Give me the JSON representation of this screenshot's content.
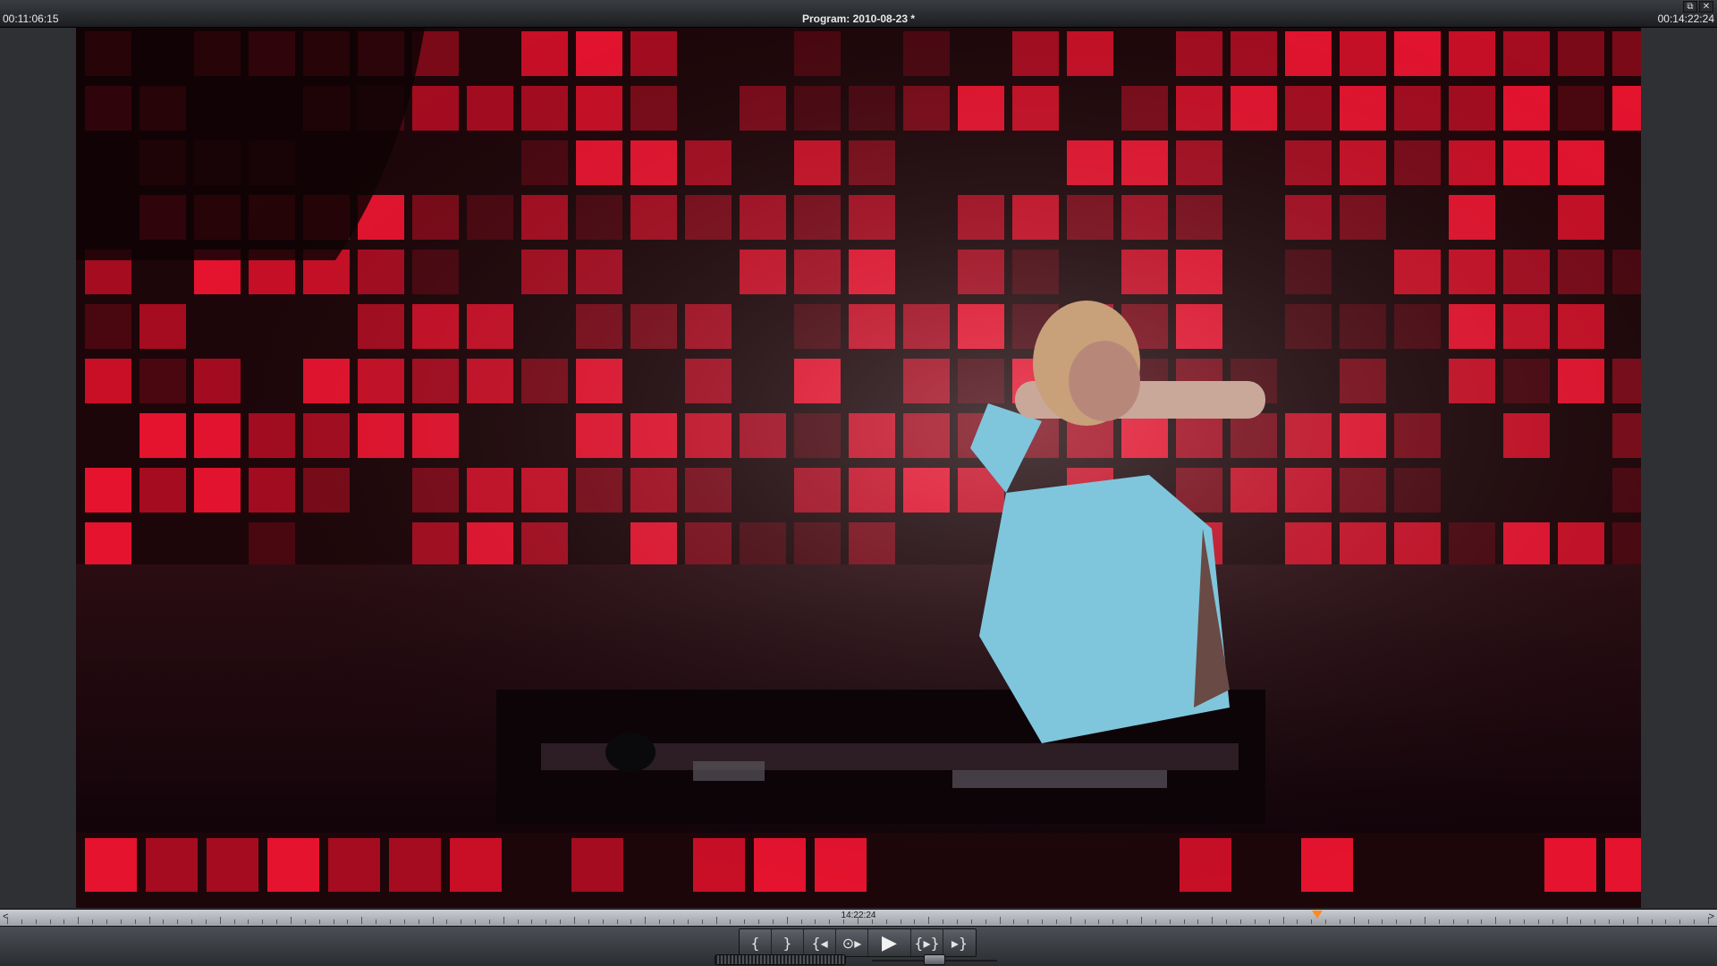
{
  "window": {
    "title": "Program: 2010-08-23 *",
    "timecode_current": "00:11:06:15",
    "timecode_total": "00:14:22:24",
    "restore_label": "⧉",
    "close_label": "✕"
  },
  "timeline": {
    "position_timecode": "14:22:24",
    "playhead_fraction": 0.767,
    "left_marker": "<",
    "right_marker": ">"
  },
  "transport": {
    "mark_in": "{",
    "mark_out": "}",
    "go_to_in": "{◂",
    "play_in_out": "⊙▸",
    "play": "▶",
    "play_to_out": "{▸}",
    "go_to_out": "▸}"
  },
  "colors": {
    "accent_playhead": "#ff8a1c",
    "stage_red": "#e0102a"
  }
}
